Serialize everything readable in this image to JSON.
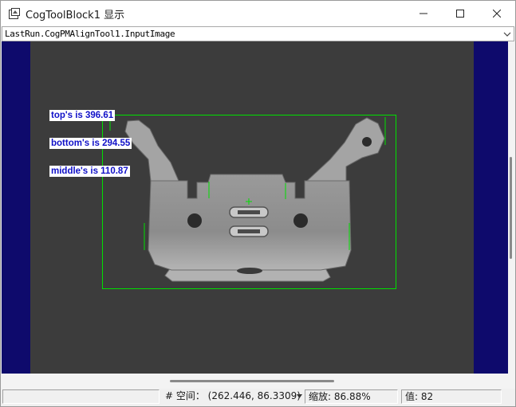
{
  "window": {
    "title": "CogToolBlock1 显示",
    "buttons": {
      "minimize": "minimize-icon",
      "maximize": "maximize-icon",
      "close": "close-icon"
    }
  },
  "image_selector": {
    "value": "LastRun.CogPMAlignTool1.InputImage",
    "icon": "chevron-down-icon"
  },
  "overlay": {
    "labels": [
      {
        "text": "top's is 396.61"
      },
      {
        "text": "bottom's is 294.55"
      },
      {
        "text": "middle's is 110.87"
      }
    ],
    "graphic_color": "#00e000",
    "label_text_color": "#1010c8"
  },
  "colors": {
    "display_background": "#0e0a6c",
    "image_background": "#3c3c3c"
  },
  "statusbar": {
    "coordinates": "# 空间： (262.446, 86.3309)",
    "zoom": "缩放:  86.88%",
    "value": "值:  82"
  }
}
